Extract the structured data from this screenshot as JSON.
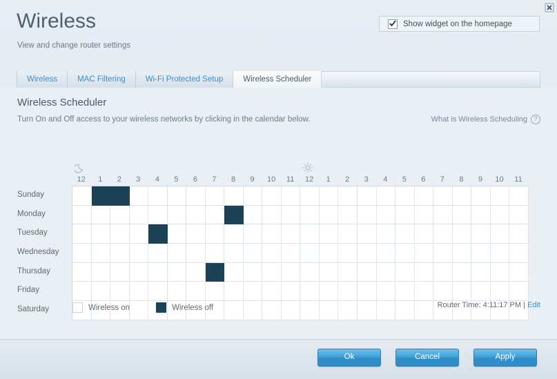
{
  "window": {
    "close_icon": "close-icon"
  },
  "header": {
    "title": "Wireless",
    "subtitle": "View and change router settings",
    "widget_checkbox": {
      "label": "Show widget on the homepage",
      "checked": true
    }
  },
  "tabs": [
    {
      "label": "Wireless",
      "active": false
    },
    {
      "label": "MAC Filtering",
      "active": false
    },
    {
      "label": "Wi-Fi Protected Setup",
      "active": false
    },
    {
      "label": "Wireless Scheduler",
      "active": true
    }
  ],
  "section": {
    "title": "Wireless Scheduler",
    "description": "Turn On and Off access to your wireless networks by clicking in the calendar below.",
    "help_label": "What is Wireless Scheduling",
    "help_icon": "question-mark-icon"
  },
  "calendar": {
    "night_icon": "moon-icon",
    "day_icon": "sun-icon",
    "hours": [
      "12",
      "1",
      "2",
      "3",
      "4",
      "5",
      "6",
      "7",
      "8",
      "9",
      "10",
      "11",
      "12",
      "1",
      "2",
      "3",
      "4",
      "5",
      "6",
      "7",
      "8",
      "9",
      "10",
      "11"
    ],
    "days": [
      "Sunday",
      "Monday",
      "Tuesday",
      "Wednesday",
      "Thursday",
      "Friday",
      "Saturday"
    ],
    "schedule": [
      [
        0,
        1,
        1,
        0,
        0,
        0,
        0,
        0,
        0,
        0,
        0,
        0,
        0,
        0,
        0,
        0,
        0,
        0,
        0,
        0,
        0,
        0,
        0,
        0
      ],
      [
        0,
        0,
        0,
        0,
        0,
        0,
        0,
        0,
        1,
        0,
        0,
        0,
        0,
        0,
        0,
        0,
        0,
        0,
        0,
        0,
        0,
        0,
        0,
        0
      ],
      [
        0,
        0,
        0,
        0,
        1,
        0,
        0,
        0,
        0,
        0,
        0,
        0,
        0,
        0,
        0,
        0,
        0,
        0,
        0,
        0,
        0,
        0,
        0,
        0
      ],
      [
        0,
        0,
        0,
        0,
        0,
        0,
        0,
        0,
        0,
        0,
        0,
        0,
        0,
        0,
        0,
        0,
        0,
        0,
        0,
        0,
        0,
        0,
        0,
        0
      ],
      [
        0,
        0,
        0,
        0,
        0,
        0,
        0,
        1,
        0,
        0,
        0,
        0,
        0,
        0,
        0,
        0,
        0,
        0,
        0,
        0,
        0,
        0,
        0,
        0
      ],
      [
        0,
        0,
        0,
        0,
        0,
        0,
        0,
        0,
        0,
        0,
        0,
        0,
        0,
        0,
        0,
        0,
        0,
        0,
        0,
        0,
        0,
        0,
        0,
        0
      ],
      [
        0,
        0,
        0,
        0,
        0,
        0,
        0,
        0,
        0,
        0,
        0,
        0,
        0,
        0,
        0,
        0,
        0,
        0,
        0,
        0,
        0,
        0,
        0,
        0
      ]
    ]
  },
  "legend": {
    "on_label": "Wireless on",
    "off_label": "Wireless off"
  },
  "router_time": {
    "prefix": "Router Time:",
    "value": "4:11:17 PM",
    "separator": "|",
    "edit_label": "Edit"
  },
  "footer": {
    "ok_label": "Ok",
    "cancel_label": "Cancel",
    "apply_label": "Apply"
  },
  "colors": {
    "accent": "#3d8ecb",
    "off_cell": "#1d4258",
    "panel_bg": "#e9eff4",
    "button": "#2f8dc8"
  }
}
